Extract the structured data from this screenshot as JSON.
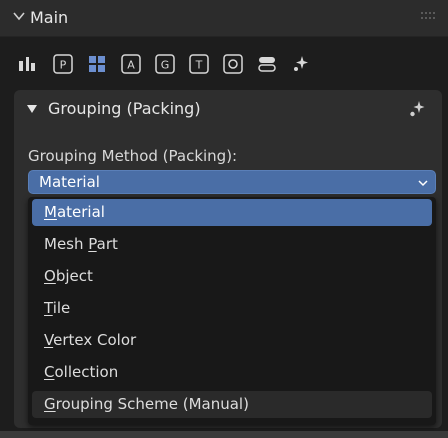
{
  "header": {
    "title": "Main"
  },
  "toolbar": {
    "icons": [
      "tool-icon",
      "p-box-icon",
      "grid-icon",
      "a-box-icon",
      "g-box-icon",
      "t-box-icon",
      "o-box-icon",
      "toggle-icon",
      "sparkle-icon"
    ]
  },
  "section": {
    "title": "Grouping (Packing)"
  },
  "field": {
    "label": "Grouping Method (Packing):",
    "value": "Material"
  },
  "menu": {
    "items": [
      {
        "pre": "",
        "u": "M",
        "post": "aterial",
        "state": "selected"
      },
      {
        "pre": "Mesh ",
        "u": "P",
        "post": "art",
        "state": ""
      },
      {
        "pre": "",
        "u": "O",
        "post": "bject",
        "state": ""
      },
      {
        "pre": "",
        "u": "T",
        "post": "ile",
        "state": ""
      },
      {
        "pre": "",
        "u": "V",
        "post": "ertex Color",
        "state": ""
      },
      {
        "pre": "",
        "u": "C",
        "post": "ollection",
        "state": ""
      },
      {
        "pre": "",
        "u": "G",
        "post": "rouping Scheme (Manual)",
        "state": "hover"
      }
    ]
  },
  "colors": {
    "accent": "#4a6ea6",
    "panel": "#2e2e2e",
    "menu": "#181818",
    "background": "#1d1d1d"
  }
}
